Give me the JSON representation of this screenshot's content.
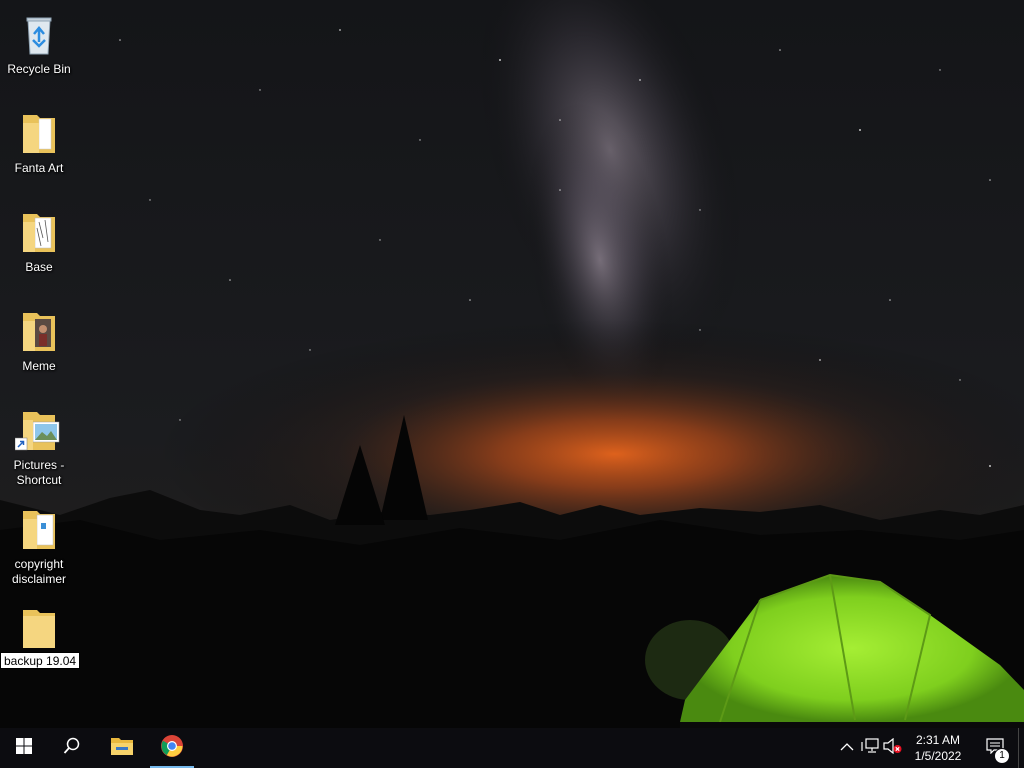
{
  "desktop": {
    "icons": [
      {
        "label": "Recycle Bin",
        "icon": "recycle-bin-icon"
      },
      {
        "label": "Fanta Art",
        "icon": "folder-icon"
      },
      {
        "label": "Base",
        "icon": "folder-icon"
      },
      {
        "label": "Meme",
        "icon": "folder-icon"
      },
      {
        "label": "Pictures - Shortcut",
        "icon": "folder-shortcut-icon"
      },
      {
        "label": "copyright disclaimer",
        "icon": "folder-icon"
      },
      {
        "label": "backup 19.04.",
        "icon": "folder-icon",
        "renaming": true
      }
    ]
  },
  "taskbar": {
    "buttons": [
      {
        "name": "start",
        "icon": "windows-logo-icon"
      },
      {
        "name": "search",
        "icon": "search-icon"
      },
      {
        "name": "file-explorer",
        "icon": "file-explorer-icon"
      },
      {
        "name": "chrome",
        "icon": "chrome-icon",
        "active": true
      }
    ],
    "tray": {
      "icons": [
        "chevron-up-icon",
        "network-icon",
        "volume-muted-icon"
      ],
      "time": "2:31 AM",
      "date": "1/5/2022",
      "notification_count": "1"
    }
  },
  "colors": {
    "taskbar_bg": "#0c0c10",
    "folder_yellow": "#f5d680",
    "active_indicator": "#76b9ed",
    "tent_green": "#9be32d",
    "horizon_orange": "#e8651c"
  }
}
